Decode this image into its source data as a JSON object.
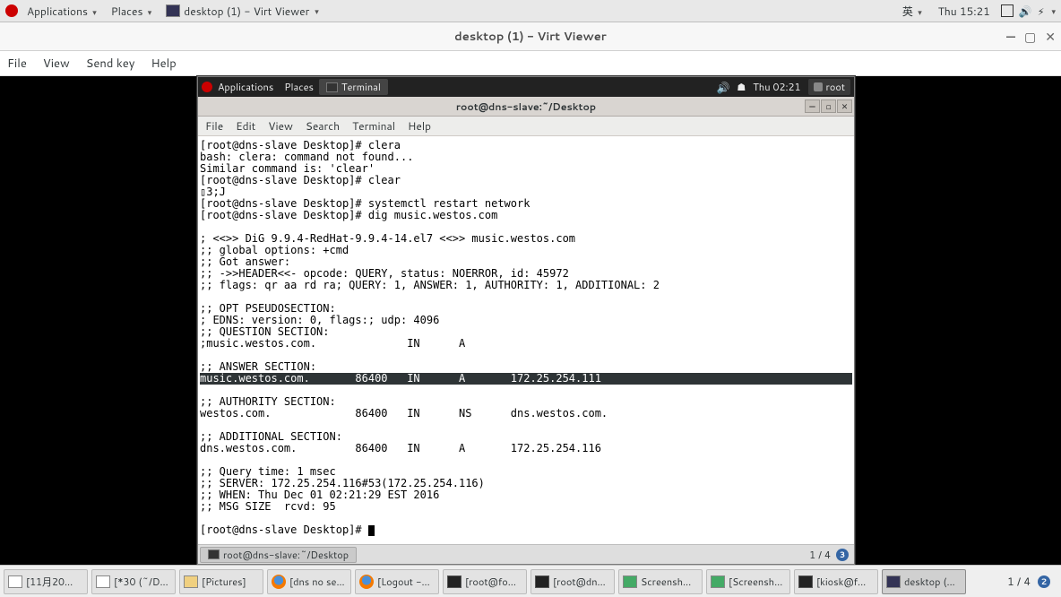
{
  "host_panel": {
    "applications": "Applications",
    "places": "Places",
    "task_title": "desktop (1) - Virt Viewer",
    "ime": "英",
    "clock": "Thu 15:21"
  },
  "vv": {
    "title": "desktop (1) - Virt Viewer",
    "menu": {
      "file": "File",
      "view": "View",
      "sendkey": "Send key",
      "help": "Help"
    }
  },
  "guest_panel": {
    "applications": "Applications",
    "places": "Places",
    "task": "Terminal",
    "clock": "Thu 02:21",
    "user": "root"
  },
  "terminal": {
    "title": "root@dns-slave:~/Desktop",
    "menu": {
      "file": "File",
      "edit": "Edit",
      "view": "View",
      "search": "Search",
      "terminal": "Terminal",
      "help": "Help"
    },
    "lines": [
      "[root@dns-slave Desktop]# clera",
      "bash: clera: command not found...",
      "Similar command is: 'clear'",
      "[root@dns-slave Desktop]# clear",
      "▯3;J",
      "[root@dns-slave Desktop]# systemctl restart network",
      "[root@dns-slave Desktop]# dig music.westos.com",
      "",
      "; <<>> DiG 9.9.4-RedHat-9.9.4-14.el7 <<>> music.westos.com",
      ";; global options: +cmd",
      ";; Got answer:",
      ";; ->>HEADER<<- opcode: QUERY, status: NOERROR, id: 45972",
      ";; flags: qr aa rd ra; QUERY: 1, ANSWER: 1, AUTHORITY: 1, ADDITIONAL: 2",
      "",
      ";; OPT PSEUDOSECTION:",
      "; EDNS: version: 0, flags:; udp: 4096",
      ";; QUESTION SECTION:",
      ";music.westos.com.              IN      A",
      "",
      ";; ANSWER SECTION:"
    ],
    "highlight": "music.westos.com.       86400   IN      A       172.25.254.111",
    "lines2": [
      "",
      ";; AUTHORITY SECTION:",
      "westos.com.             86400   IN      NS      dns.westos.com.",
      "",
      ";; ADDITIONAL SECTION:",
      "dns.westos.com.         86400   IN      A       172.25.254.116",
      "",
      ";; Query time: 1 msec",
      ";; SERVER: 172.25.254.116#53(172.25.254.116)",
      ";; WHEN: Thu Dec 01 02:21:29 EST 2016",
      ";; MSG SIZE  rcvd: 95",
      "",
      "[root@dns-slave Desktop]# "
    ]
  },
  "guest_bottombar": {
    "task": "root@dns-slave:~/Desktop",
    "ws": "1 / 4",
    "dot": "3"
  },
  "host_bottombar": {
    "tasks": [
      {
        "icon": "doc",
        "label": "[11月20..."
      },
      {
        "icon": "doc",
        "label": "[*30 (~/D..."
      },
      {
        "icon": "folder",
        "label": "[Pictures]"
      },
      {
        "icon": "ff",
        "label": "[dns no se..."
      },
      {
        "icon": "ff",
        "label": "[Logout -..."
      },
      {
        "icon": "term",
        "label": "[root@fo..."
      },
      {
        "icon": "term",
        "label": "[root@dn..."
      },
      {
        "icon": "screenshot",
        "label": "Screensh..."
      },
      {
        "icon": "screenshot",
        "label": "[Screensh..."
      },
      {
        "icon": "term",
        "label": "[kiosk@f..."
      },
      {
        "icon": "vv",
        "label": "desktop (...",
        "active": true
      }
    ],
    "ws": "1 / 4",
    "dot": "2"
  }
}
